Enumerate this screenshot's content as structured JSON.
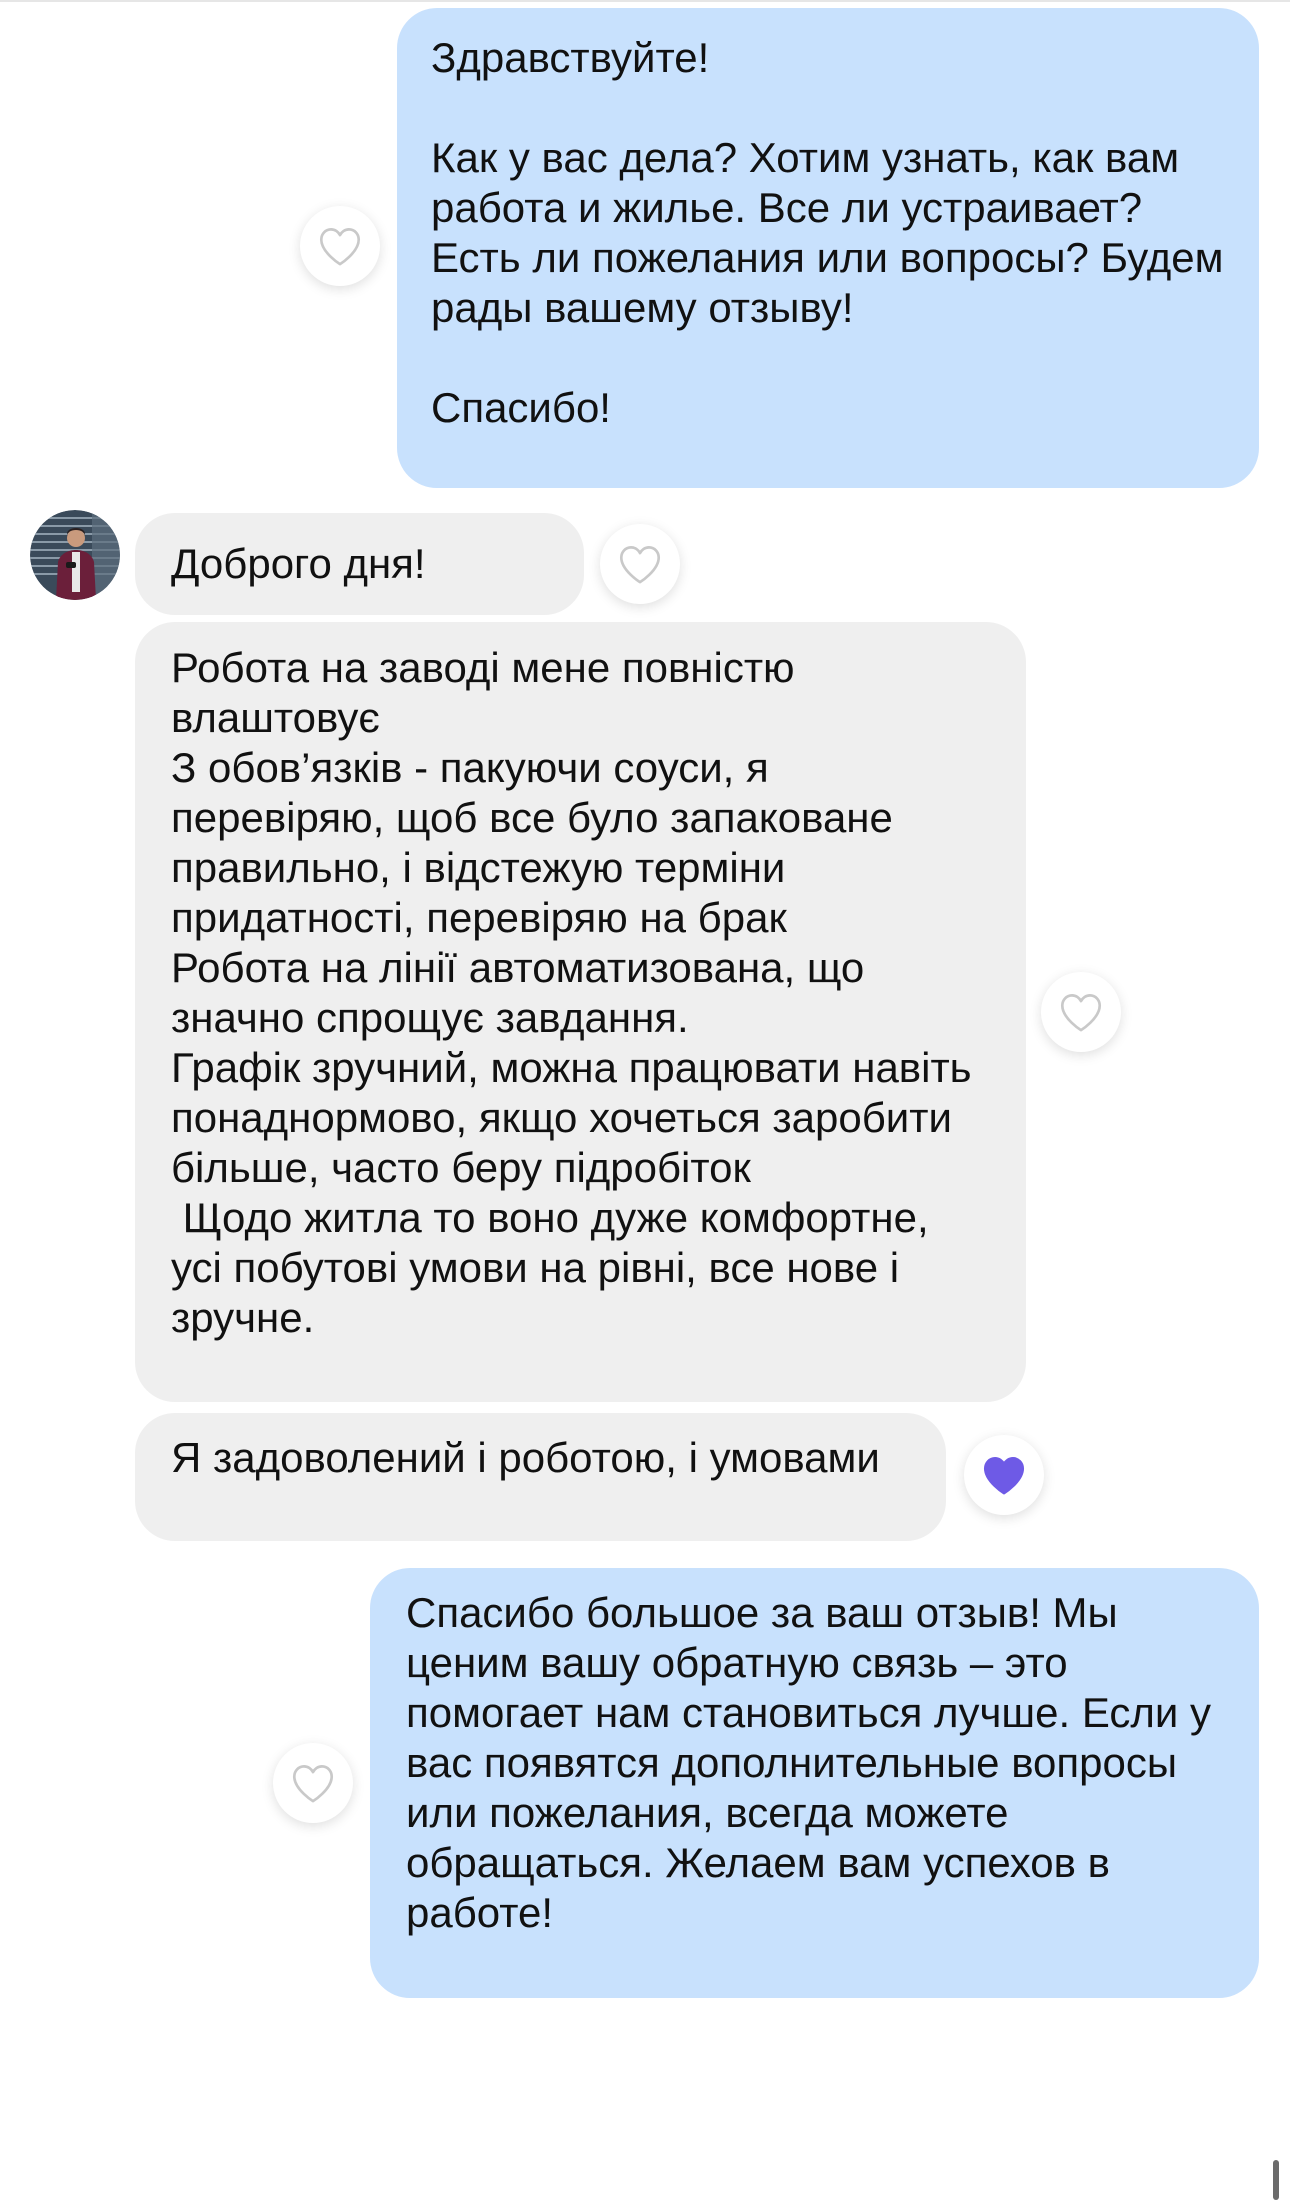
{
  "messages": [
    {
      "id": "m1",
      "direction": "outgoing",
      "text": "Здравствуйте!\n\nКак у вас дела? Хотим узнать, как вам работа и жилье. Все ли устраивает? Есть ли пожелания или вопросы? Будем рады вашему отзыву!\n\nСпасибо!",
      "liked": false
    },
    {
      "id": "m2",
      "direction": "incoming",
      "text": "Доброго дня!",
      "liked": false
    },
    {
      "id": "m3",
      "direction": "incoming",
      "text": "Робота на заводі мене повністю влаштовує\nЗ обов’язків - пакуючи соуси, я перевіряю, щоб все було запаковане правильно, і відстежую терміни придатності, перевіряю на брак\nРобота на лінії автоматизована, що значно спрощує завдання.\nГрафік зручний, можна працювати навіть понаднормово, якщо хочеться заробити більше, часто беру підробіток\n Щодо житла то воно дуже комфортне, усі побутові умови на рівні, все нове і зручне.",
      "liked": false
    },
    {
      "id": "m4",
      "direction": "incoming",
      "text": "Я задоволений і роботою, і умовами",
      "liked": true
    },
    {
      "id": "m5",
      "direction": "outgoing",
      "text": "Спасибо большое за ваш отзыв! Мы ценим вашу обратную связь – это помогает нам становиться лучше. Если у вас появятся дополнительные вопросы или пожелания, всегда можете обращаться. Желаем вам успехов в работе!",
      "liked": false
    }
  ],
  "colors": {
    "outgoing_bubble": "#c8e1fd",
    "incoming_bubble": "#efefef",
    "liked_heart": "#6e5ae6",
    "unliked_heart_outline": "#c9c9c9"
  },
  "icons": {
    "like": "heart-icon",
    "avatar": "user-avatar"
  }
}
